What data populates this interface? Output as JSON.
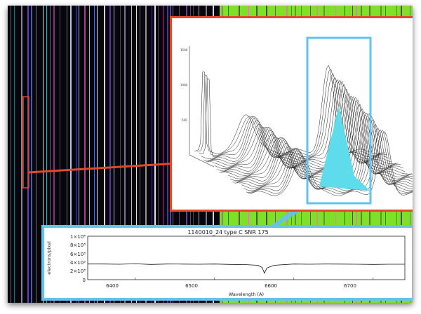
{
  "spectrum": {
    "title": "1140010_24   type C   SNR 175",
    "ylabel": "electrons/pixel",
    "xlabel": "Wavelength (A)",
    "y_ticks": [
      "1×10⁴",
      "8×10³",
      "6×10³",
      "4×10³",
      "2×10³",
      "0"
    ],
    "x_ticks": [
      "6400",
      "6500",
      "6600",
      "6700"
    ]
  },
  "surface_plot": {
    "z_ticks": [
      "1500",
      "1000",
      "500"
    ]
  },
  "colors": {
    "callout_red": "#e4472a",
    "callout_blue": "#63c3ec",
    "peak_fill": "#5fdcec",
    "detector_bg": "#07060c",
    "green_panel": "#7fe02a"
  },
  "chart_data": {
    "type": "line",
    "title": "1140010_24   type C   SNR 175",
    "xlabel": "Wavelength (A)",
    "ylabel": "electrons/pixel",
    "xlim": [
      6340,
      6740
    ],
    "ylim": [
      0,
      10000
    ],
    "series": [
      {
        "x": [
          6340,
          6360,
          6380,
          6400,
          6420,
          6440,
          6460,
          6480,
          6500,
          6520,
          6540,
          6555,
          6560,
          6562.8,
          6566,
          6575,
          6600,
          6620,
          6640,
          6660,
          6680,
          6700,
          6720,
          6740
        ],
        "values": [
          3600,
          3600,
          3550,
          3650,
          3500,
          3600,
          3580,
          3550,
          3600,
          3500,
          3450,
          3300,
          2800,
          1500,
          2700,
          3300,
          3600,
          3550,
          3600,
          3580,
          3550,
          3500,
          3550,
          3550
        ]
      }
    ]
  }
}
